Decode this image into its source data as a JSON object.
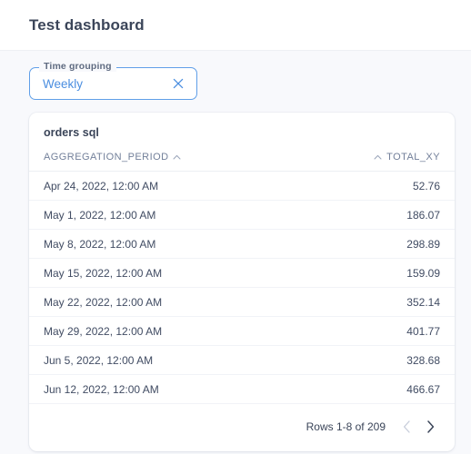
{
  "header": {
    "title": "Test dashboard"
  },
  "filters": [
    {
      "label": "Time grouping",
      "value": "Weekly",
      "clear_icon": "close-icon"
    }
  ],
  "card": {
    "title": "orders sql",
    "table": {
      "columns": [
        {
          "label": "AGGREGATION_PERIOD",
          "align": "left",
          "sort_icon": "chevron-up-icon",
          "sort_position": "after"
        },
        {
          "label": "TOTAL_XY",
          "align": "right",
          "sort_icon": "chevron-up-icon",
          "sort_position": "before"
        }
      ],
      "rows": [
        {
          "period": "Apr 24, 2022, 12:00 AM",
          "total": "52.76"
        },
        {
          "period": "May 1, 2022, 12:00 AM",
          "total": "186.07"
        },
        {
          "period": "May 8, 2022, 12:00 AM",
          "total": "298.89"
        },
        {
          "period": "May 15, 2022, 12:00 AM",
          "total": "159.09"
        },
        {
          "period": "May 22, 2022, 12:00 AM",
          "total": "352.14"
        },
        {
          "period": "May 29, 2022, 12:00 AM",
          "total": "401.77"
        },
        {
          "period": "Jun 5, 2022, 12:00 AM",
          "total": "328.68"
        },
        {
          "period": "Jun 12, 2022, 12:00 AM",
          "total": "466.67"
        }
      ]
    },
    "footer": {
      "rows_label": "Rows 1-8 of 209",
      "prev_icon": "chevron-left-icon",
      "next_icon": "chevron-right-icon",
      "prev_enabled": false,
      "next_enabled": true
    }
  },
  "colors": {
    "page_bg": "#f8f9fc",
    "card_bg": "#ffffff",
    "accent_blue": "#4b8ee0",
    "filter_border": "#609fe8",
    "text_dark": "#3b4559",
    "text_muted": "#73809a",
    "pager_disabled": "#c7cdda",
    "pager_enabled": "#3b4559"
  }
}
